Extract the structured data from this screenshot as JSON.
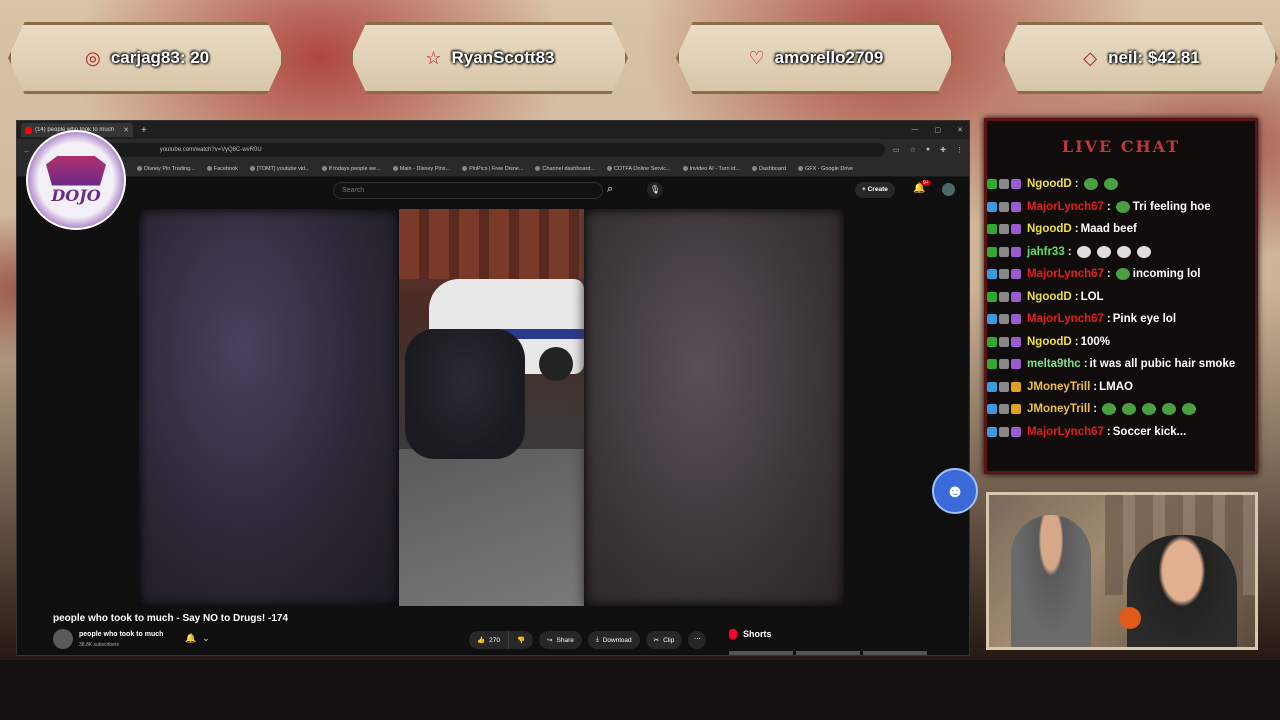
{
  "banners": [
    {
      "text": "carjag83: 20",
      "icon": "coin-stack-icon"
    },
    {
      "text": "RyanScott83",
      "icon": "star-icon"
    },
    {
      "text": "amorello2709",
      "icon": "heart-hands-icon"
    },
    {
      "text": "neil: $42.81",
      "icon": "diamond-icon"
    }
  ],
  "browser": {
    "tab_title": "(14) people who took to much",
    "url": "youtube.com/watch?v=VyQ6C-wvR0U",
    "bookmarks": [
      "Disney Pin Trading...",
      "Facebook",
      "[TOMT] youtube vid...",
      "If todays people we...",
      "Main - Disney Pins...",
      "PinPics | Free Disne...",
      "Channel dashboard...",
      "CDTFA Online Servic...",
      "Invideo AI - Turn id...",
      "Dashboard",
      "GFX - Google Drive"
    ]
  },
  "youtube": {
    "search_placeholder": "Search",
    "create_label": "Create",
    "notif_count": "9+",
    "video_title": "people who took to much - Say NO to Drugs! -174",
    "channel_name": "people who took to much",
    "subscribers": "38.8K subscribers",
    "likes": "270",
    "share_label": "Share",
    "download_label": "Download",
    "clip_label": "Clip",
    "shorts_label": "Shorts"
  },
  "dojo_logo_text": "DOJO",
  "chat": {
    "title": "LIVE CHAT",
    "messages": [
      {
        "name": "NgoodD",
        "color": "#f0e040",
        "msg": "",
        "emotes": 2
      },
      {
        "name": "MajorLynch67",
        "color": "#e02020",
        "msg": "Tri feeling hoe",
        "emotes": 1
      },
      {
        "name": "NgoodD",
        "color": "#f0e040",
        "msg": "Maad beef",
        "emotes": 0
      },
      {
        "name": "jahfr33",
        "color": "#60e060",
        "msg": "",
        "emotes": 4
      },
      {
        "name": "MajorLynch67",
        "color": "#e02020",
        "msg": "incoming lol",
        "emotes": 1
      },
      {
        "name": "NgoodD",
        "color": "#f0e040",
        "msg": "LOL",
        "emotes": 0
      },
      {
        "name": "MajorLynch67",
        "color": "#e02020",
        "msg": "Pink eye lol",
        "emotes": 0
      },
      {
        "name": "NgoodD",
        "color": "#f0e040",
        "msg": "100%",
        "emotes": 0
      },
      {
        "name": "melta9thc",
        "color": "#80e080",
        "msg": "it was all pubic hair smoke",
        "emotes": 0
      },
      {
        "name": "JMoneyTrill",
        "color": "#f0c040",
        "msg": "LMAO",
        "emotes": 0
      },
      {
        "name": "JMoneyTrill",
        "color": "#f0c040",
        "msg": "",
        "emotes": 5
      },
      {
        "name": "MajorLynch67",
        "color": "#e02020",
        "msg": "Soccer kick...",
        "emotes": 0
      }
    ]
  }
}
